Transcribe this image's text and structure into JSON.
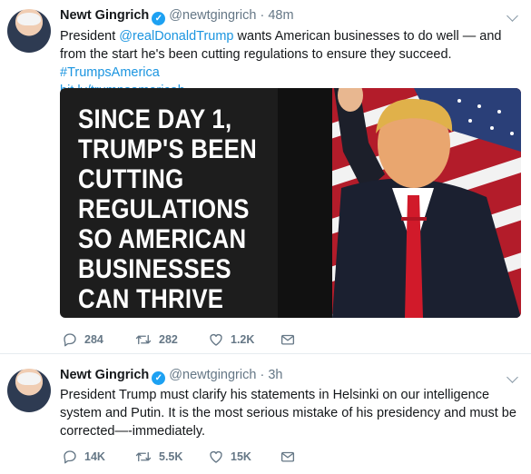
{
  "tweets": [
    {
      "author": "Newt Gingrich",
      "handle": "@newtgingrich",
      "separator": "·",
      "time": "48m",
      "text_1": "President ",
      "mention": "@realDonaldTrump",
      "text_2": " wants American businesses to do well — and from the start he's been cutting regulations to ensure they succeed. ",
      "hashtag": "#TrumpsAmerica",
      "link": "bit.ly/trumpsamericab…",
      "media_lines": [
        "SINCE DAY 1,",
        "TRUMP'S BEEN",
        "CUTTING",
        "REGULATIONS",
        "SO AMERICAN",
        "BUSINESSES",
        "CAN THRIVE"
      ],
      "replies": "284",
      "retweets": "282",
      "likes": "1.2K"
    },
    {
      "author": "Newt Gingrich",
      "handle": "@newtgingrich",
      "separator": "·",
      "time": "3h",
      "text": "President Trump must clarify his statements in Helsinki on our intelligence system and Putin. It is the most serious mistake of his presidency and must be corrected—-immediately.",
      "replies": "14K",
      "retweets": "5.5K",
      "likes": "15K"
    }
  ],
  "icons": {
    "verified": "verified-badge-icon",
    "reply": "reply-icon",
    "retweet": "retweet-icon",
    "like": "heart-icon",
    "message": "envelope-icon",
    "menu": "chevron-down-icon"
  },
  "colors": {
    "link": "#1b95e0",
    "verified": "#1da1f2",
    "muted": "#657786",
    "tie": "#d11a2a"
  }
}
